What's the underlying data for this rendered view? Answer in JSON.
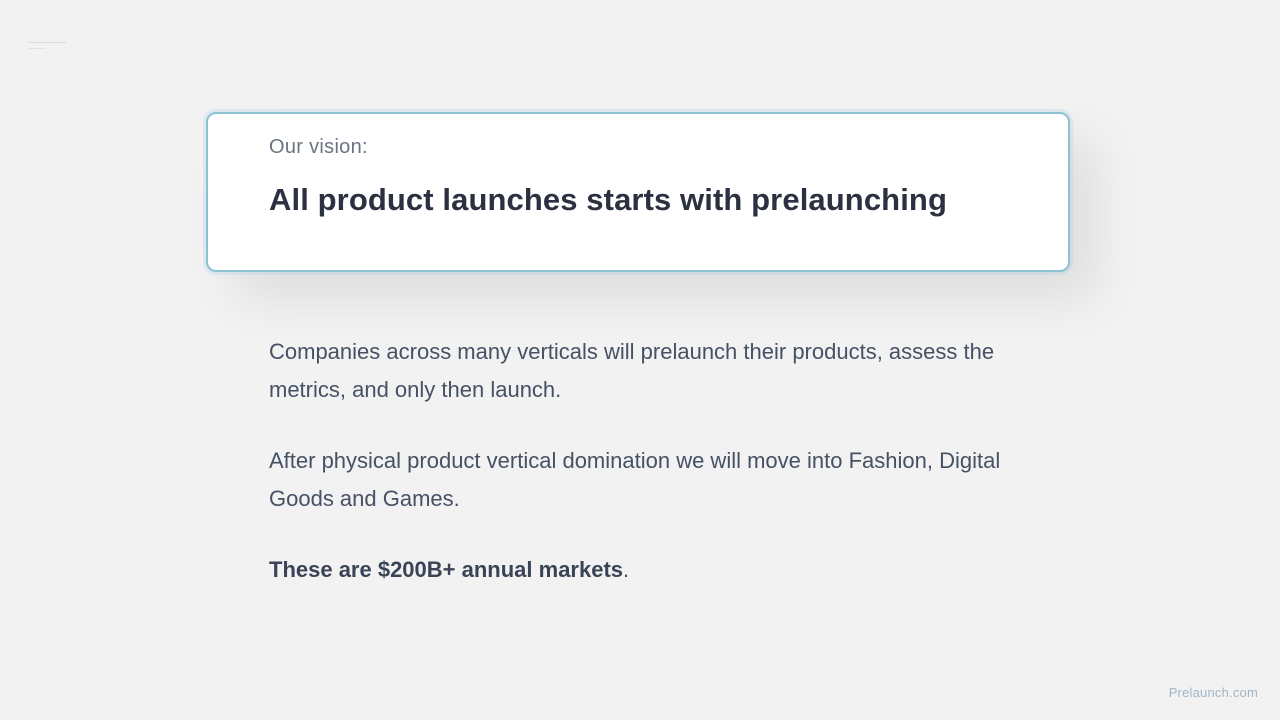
{
  "vision_card": {
    "label": "Our vision:",
    "headline": "All product launches starts with prelaunching"
  },
  "body": {
    "paragraph_1": "Companies across many verticals will prelaunch their products, assess the metrics, and only then launch.",
    "paragraph_2": "After physical product vertical domination we will move into Fashion, Digital Goods and Games.",
    "market_statement": "These are $200B+ annual markets",
    "market_period": "."
  },
  "footer": {
    "brand": "Prelaunch.com"
  },
  "colors": {
    "background": "#f2f2f3",
    "card_border": "#8cc3d3",
    "headline": "#2b3140",
    "body_text": "#465164",
    "footer_brand": "#9fb6c6"
  }
}
